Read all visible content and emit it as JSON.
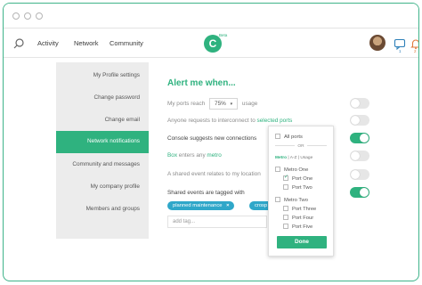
{
  "nav": {
    "links": [
      "Activity",
      "Network",
      "Community"
    ],
    "logo_letter": "C",
    "logo_beta": "Beta",
    "message_count": "1",
    "notification_count": "2"
  },
  "sidebar": {
    "items": [
      {
        "label": "My Profile settings"
      },
      {
        "label": "Change password"
      },
      {
        "label": "Change email"
      },
      {
        "label": "Network notifications",
        "active": true
      },
      {
        "label": "Community and messages"
      },
      {
        "label": "My company profile"
      },
      {
        "label": "Members and groups"
      }
    ]
  },
  "panel": {
    "title": "Alert me when...",
    "rows": {
      "ports_reach_prefix": "My ports reach",
      "ports_reach_value": "75%",
      "ports_reach_suffix": "usage",
      "interconnect_prefix": "Anyone requests to interconnect to",
      "interconnect_link": "selected ports",
      "console_suggests": "Console suggests new connections",
      "box_link": "Box",
      "box_suffix": "enters any",
      "metro_link": "metro",
      "shared_event": "A shared event relates to my location",
      "shared_tagged": "Shared events are tagged with"
    },
    "tags": [
      "planned maintenance",
      "crosp"
    ],
    "add_tag_placeholder": "add tag..."
  },
  "toggles": [
    false,
    false,
    true,
    false,
    false,
    true
  ],
  "dropdown": {
    "all_ports": "All ports",
    "or": "OR",
    "filter": {
      "metro": "Metro",
      "az": "A-Z",
      "usage": "Usage",
      "sep": "|"
    },
    "groups": [
      {
        "label": "Metro One",
        "ports": [
          {
            "label": "Port One",
            "checked": true
          },
          {
            "label": "Port Two",
            "checked": false
          }
        ]
      },
      {
        "label": "Metro Two",
        "ports": [
          {
            "label": "Port Three",
            "checked": false
          },
          {
            "label": "Port Four",
            "checked": false
          },
          {
            "label": "Port Five",
            "checked": false
          }
        ]
      }
    ],
    "done_label": "Done"
  },
  "colors": {
    "accent": "#2fb27f",
    "tag": "#2fa7c9",
    "frame": "#3fb38a"
  }
}
